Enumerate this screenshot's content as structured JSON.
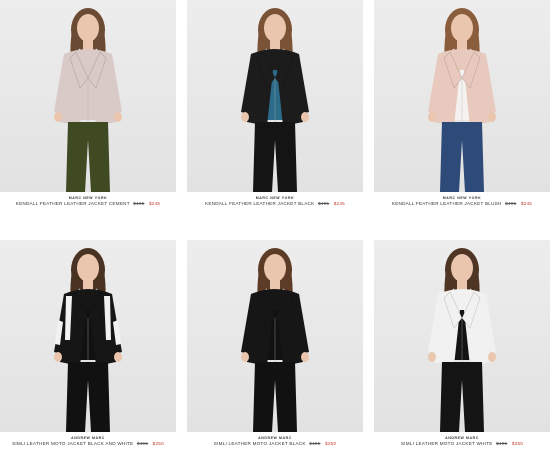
{
  "products": [
    {
      "brand": "MARC NEW YORK",
      "name": "KENDALL FEATHER LEATHER JACKET CEMENT",
      "old_price": "$495",
      "price": "$245",
      "jacket_color": "#d9c9c7",
      "pants_color": "#3f4a22",
      "top_color": "#d9c9c7",
      "hair_color": "#6b4a34"
    },
    {
      "brand": "MARC NEW YORK",
      "name": "KENDALL FEATHER LEATHER JACKET BLACK",
      "old_price": "$495",
      "price": "$245",
      "jacket_color": "#1c1c1c",
      "pants_color": "#141414",
      "top_color": "#2c6b8a",
      "hair_color": "#7a5236"
    },
    {
      "brand": "MARC NEW YORK",
      "name": "KENDALL FEATHER LEATHER JACKET BLUSH",
      "old_price": "$495",
      "price": "$245",
      "jacket_color": "#e8c9bd",
      "pants_color": "#2e4a78",
      "top_color": "#f4f2ef",
      "hair_color": "#8a5e3c"
    },
    {
      "brand": "ANDREW MARC",
      "name": "SIMLI LEATHER MOTO JACKET BLACK AND WHITE",
      "old_price": "$495",
      "price": "$250",
      "jacket_color": "#161616",
      "pants_color": "#111111",
      "top_color": "#111111",
      "hair_color": "#4a3222"
    },
    {
      "brand": "ANDREW MARC",
      "name": "SIMLI LEATHER MOTO JACKET BLACK",
      "old_price": "$495",
      "price": "$250",
      "jacket_color": "#161616",
      "pants_color": "#111111",
      "top_color": "#111111",
      "hair_color": "#5c3c26"
    },
    {
      "brand": "ANDREW MARC",
      "name": "SIMLI LEATHER MOTO JACKET WHITE",
      "old_price": "$495",
      "price": "$250",
      "jacket_color": "#f1f1f1",
      "pants_color": "#141414",
      "top_color": "#141414",
      "hair_color": "#4e3524"
    }
  ]
}
